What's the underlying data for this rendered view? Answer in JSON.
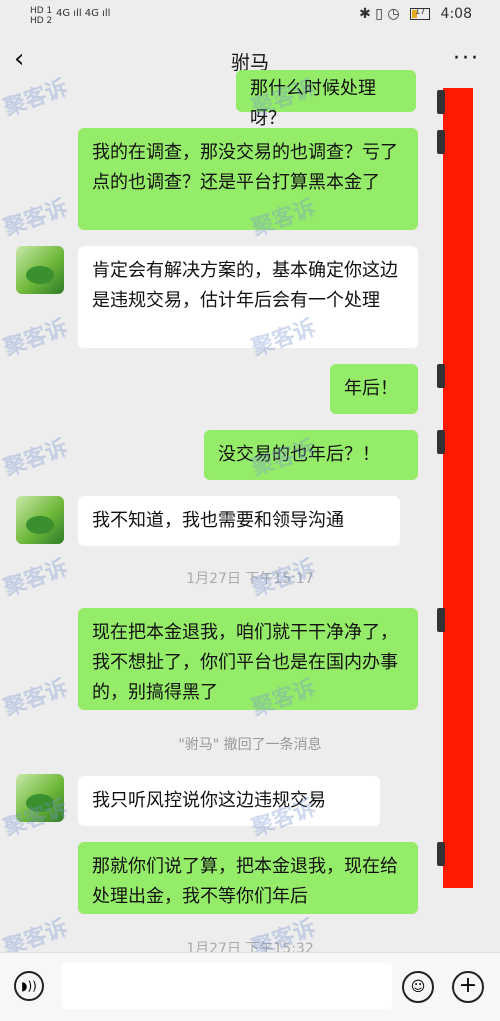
{
  "status_bar": {
    "sim_labels": [
      "HD 1",
      "HD 2"
    ],
    "signal": "4G ıll 4G ıll",
    "battery_level": "17",
    "time": "4:08"
  },
  "nav": {
    "back_glyph": "‹",
    "title": "驸马",
    "more_glyph": "···"
  },
  "messages": [
    {
      "side": "out",
      "text": "那什么时候处理呀？"
    },
    {
      "side": "out",
      "text": "我的在调查，那没交易的也调查？亏了点的也调查？还是平台打算黑本金了"
    },
    {
      "side": "in",
      "text": "肯定会有解决方案的，基本确定你这边是违规交易，估计年后会有一个处理"
    },
    {
      "side": "out",
      "text": "年后！"
    },
    {
      "side": "out",
      "text": "没交易的也年后？！"
    },
    {
      "side": "in",
      "text": "我不知道，我也需要和领导沟通"
    },
    {
      "side": "out",
      "text": "现在把本金退我，咱们就干干净净了，我不想扯了，你们平台也是在国内办事的，别搞得黑了"
    },
    {
      "side": "in",
      "text": "我只听风控说你这边违规交易"
    },
    {
      "side": "out",
      "text": "那就你们说了算，把本金退我，现在给处理出金，我不等你们年后"
    }
  ],
  "timestamps": [
    "1月27日 下午15:17",
    "1月27日 下午15:32"
  ],
  "recall_notice": "\"驸马\" 撤回了一条消息",
  "watermark": "聚客诉",
  "input_bar": {
    "voice_icon": "voice-icon",
    "emoji_icon": "emoji-icon",
    "plus_icon": "plus-icon"
  },
  "colors": {
    "outgoing_bubble": "#95ec69",
    "incoming_bubble": "#ffffff",
    "redaction": "#ff1a00",
    "background": "#ededed"
  }
}
